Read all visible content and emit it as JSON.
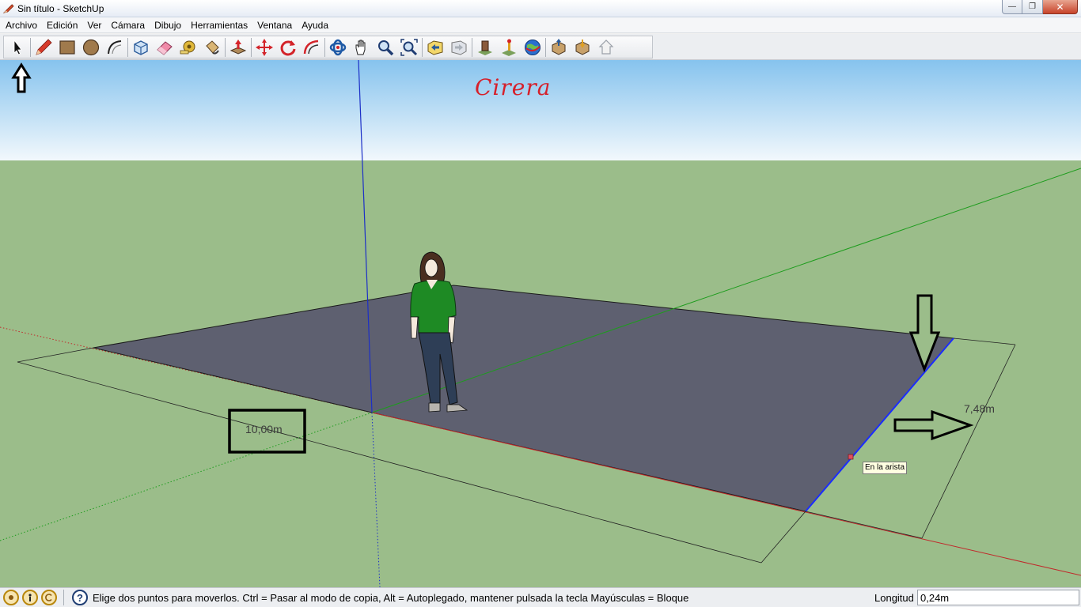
{
  "window": {
    "title": "Sin título - SketchUp",
    "controls": {
      "minimize": "—",
      "maximize": "❐",
      "close": "✕"
    }
  },
  "menu": [
    "Archivo",
    "Edición",
    "Ver",
    "Cámara",
    "Dibujo",
    "Herramientas",
    "Ventana",
    "Ayuda"
  ],
  "toolbar": {
    "groups": [
      [
        "select-tool-icon"
      ],
      [
        "pencil-line-icon",
        "rectangle-icon",
        "circle-icon",
        "arc-icon"
      ],
      [
        "make-component-icon",
        "eraser-icon",
        "tape-measure-icon",
        "paint-bucket-icon"
      ],
      [
        "push-pull-icon"
      ],
      [
        "move-icon",
        "rotate-icon",
        "offset-icon"
      ],
      [
        "orbit-icon",
        "pan-icon",
        "zoom-icon",
        "zoom-extents-icon"
      ],
      [
        "previous-view-icon",
        "next-view-icon"
      ],
      [
        "add-location-icon",
        "toggle-terrain-icon",
        "google-earth-icon"
      ],
      [
        "get-models-icon",
        "share-model-icon",
        "get-components-icon"
      ]
    ]
  },
  "viewport": {
    "watermark": "Cirera",
    "dimensions": {
      "length": "10,00m",
      "width": "7,48m"
    },
    "inference_tooltip": "En la arista",
    "colors": {
      "sky": "#cfe8f8",
      "ground": "#9bbd8a",
      "face": "#5e6070",
      "red_axis": "#c0292b",
      "green_axis": "#1d9c1d",
      "blue_axis": "#1c2fc7",
      "selected_edge": "#1a2cff"
    }
  },
  "statusbar": {
    "message": "Elige dos puntos para moverlos. Ctrl = Pasar al modo de copia, Alt = Autoplegado, mantener pulsada la tecla Mayúsculas = Bloque",
    "measure_label": "Longitud",
    "measure_value": "0,24m"
  }
}
